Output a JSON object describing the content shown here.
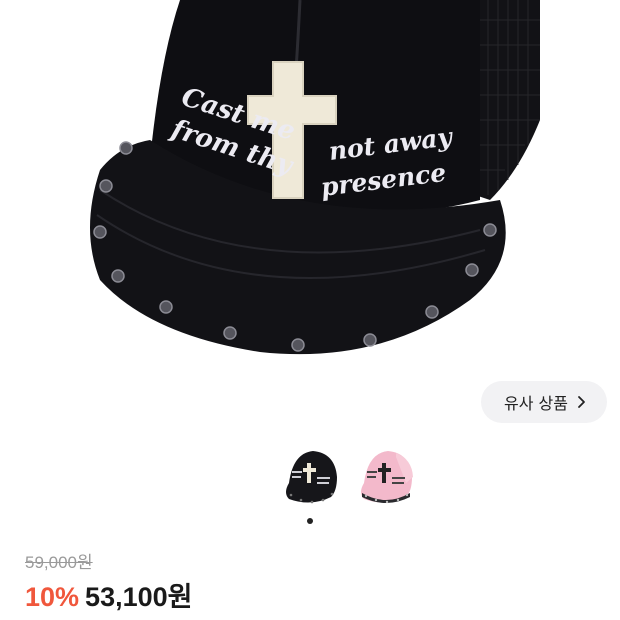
{
  "product": {
    "hat_text": {
      "left_line1": "Cast me",
      "left_line2": "from thy",
      "right_line1": "not away",
      "right_line2": "presence"
    },
    "similar_button_label": "유사 상품",
    "thumbnails": [
      {
        "name": "black cap",
        "color": "#1a1a1e"
      },
      {
        "name": "pink cap",
        "color": "#f3b9cb"
      }
    ],
    "original_price": "59,000원",
    "discount": "10%",
    "price": "53,100원"
  },
  "colors": {
    "discount": "#f0573c",
    "button_bg": "#f2f2f4"
  }
}
